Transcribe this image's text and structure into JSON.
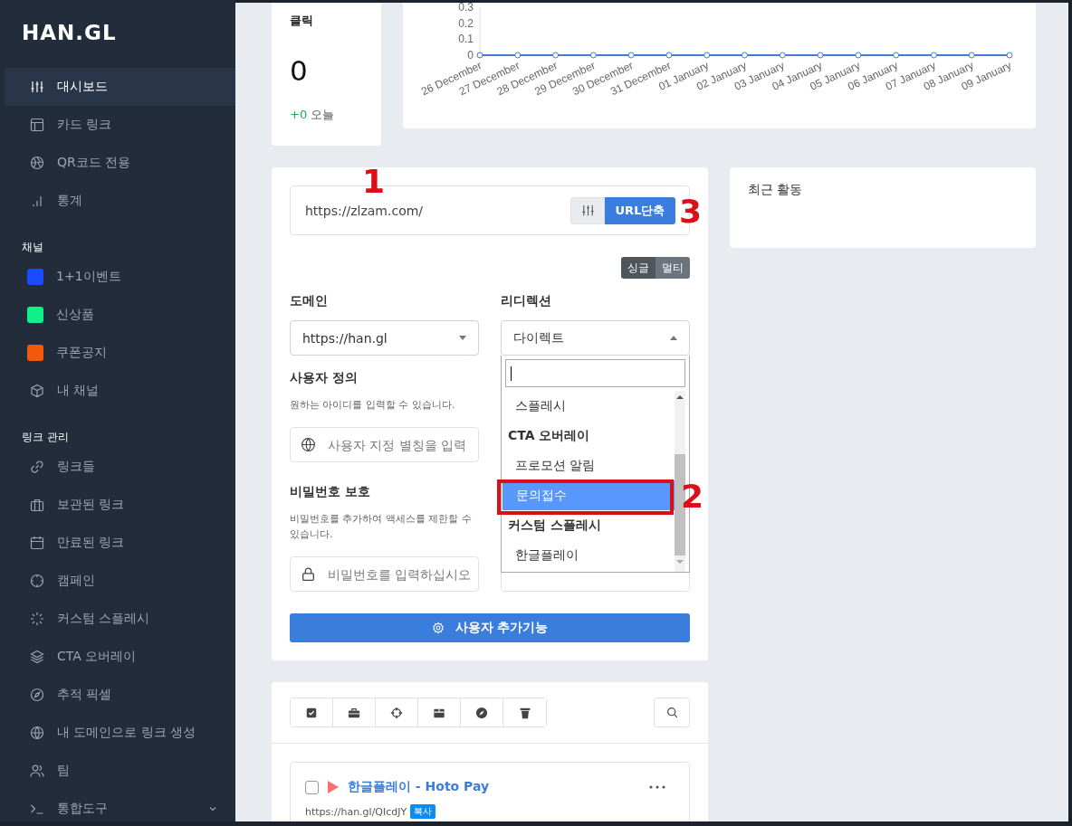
{
  "sidebar": {
    "logo": "HAN.GL",
    "groups": [
      {
        "items": [
          {
            "kind": "link",
            "label": "대시보드",
            "selected": true
          },
          {
            "kind": "link",
            "label": "카드 링크",
            "selected": false
          },
          {
            "kind": "link",
            "label": "QR코드 전용",
            "selected": false
          },
          {
            "kind": "link",
            "label": "통계",
            "selected": false
          }
        ]
      },
      {
        "heading": "채널",
        "items": [
          {
            "kind": "channel",
            "label": "1+1이벤트",
            "color": "#1a4cff",
            "selected": false
          },
          {
            "kind": "channel",
            "label": "신상품",
            "color": "#12f08a",
            "selected": false
          },
          {
            "kind": "channel",
            "label": "쿠폰공지",
            "color": "#f05a0a",
            "selected": false
          },
          {
            "kind": "link",
            "label": "내 채널",
            "selected": false
          }
        ]
      },
      {
        "heading": "링크 관리",
        "items": [
          {
            "kind": "link",
            "label": "링크들",
            "selected": false
          },
          {
            "kind": "link",
            "label": "보관된 링크",
            "selected": false
          },
          {
            "kind": "link",
            "label": "만료된 링크",
            "selected": false
          },
          {
            "kind": "link",
            "label": "캠페인",
            "selected": false
          },
          {
            "kind": "link",
            "label": "커스텀 스플레시",
            "selected": false
          },
          {
            "kind": "link",
            "label": "CTA 오버레이",
            "selected": false
          },
          {
            "kind": "link",
            "label": "추적 픽셀",
            "selected": false
          },
          {
            "kind": "link",
            "label": "내 도메인으로 링크 생성",
            "selected": false
          },
          {
            "kind": "link",
            "label": "팀",
            "selected": false
          },
          {
            "kind": "submenu",
            "label": "통합도구",
            "selected": false
          }
        ]
      }
    ]
  },
  "stat": {
    "title": "클릭",
    "value": "0",
    "delta": "+0",
    "delta_label": "오늘"
  },
  "chart": {
    "chart_data": {
      "type": "line",
      "categories": [
        "26 December",
        "27 December",
        "28 December",
        "29 December",
        "30 December",
        "31 December",
        "01 January",
        "02 January",
        "03 January",
        "04 January",
        "05 January",
        "06 January",
        "07 January",
        "08 January",
        "09 January"
      ],
      "series": [
        {
          "color": "#3b7ddd",
          "marker": "circle",
          "values": [
            0,
            0,
            0,
            0,
            0,
            0,
            0,
            0,
            0,
            0,
            0,
            0,
            0,
            0,
            0
          ]
        }
      ],
      "ylim": [
        0,
        0.3
      ],
      "yticks": [
        0,
        0.1,
        0.2,
        0.3
      ]
    }
  },
  "form": {
    "url_field": {
      "value": "https://zlzam.com/"
    },
    "shorten_button": "URL단축",
    "mode_toggle": [
      {
        "label": "싱글",
        "selected": true
      },
      {
        "label": "멀티",
        "selected": false
      }
    ],
    "domain": {
      "label": "도메인",
      "value": "https://han.gl",
      "open": false
    },
    "redirect": {
      "label": "리디렉션",
      "value": "다이렉트",
      "open": true
    },
    "redirect_options": [
      {
        "kind": "option",
        "label": "스플레시",
        "selected": false
      },
      {
        "kind": "group",
        "label": "CTA 오버레이"
      },
      {
        "kind": "option",
        "label": "프로모션 알림",
        "selected": false
      },
      {
        "kind": "option",
        "label": "문의접수",
        "selected": true
      },
      {
        "kind": "group",
        "label": "커스텀 스플레시"
      },
      {
        "kind": "option",
        "label": "한글플레이",
        "selected": false
      }
    ],
    "custom_alias": {
      "label": "사용자 정의",
      "hint": "원하는 아이디를 입력할 수 있습니다.",
      "placeholder": "사용자 지정 별칭을 입력"
    },
    "password": {
      "label": "비밀번호 보호",
      "hint": "비밀번호를 추가하여 액세스를 제한할 수 있습니다.",
      "placeholder": "비밀번호를 입력하십시오"
    },
    "extra_button": "사용자 추가기능"
  },
  "recent_activity": {
    "title": "최근 활동"
  },
  "links": [
    {
      "title": "한글플레이 - Hoto Pay",
      "url": "https://han.gl/QIcdJY",
      "copy_label": "복사",
      "checked": false
    }
  ],
  "annotations": [
    {
      "kind": "number",
      "label": "1"
    },
    {
      "kind": "number",
      "label": "3"
    },
    {
      "kind": "number",
      "label": "2"
    },
    {
      "kind": "box"
    }
  ]
}
